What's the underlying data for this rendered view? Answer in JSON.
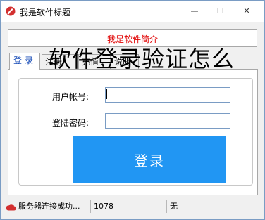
{
  "window": {
    "title": "我是软件标题",
    "minimize_glyph": "—",
    "maximize_glyph": "☐",
    "close_glyph": "✕"
  },
  "intro": {
    "text": "我是软件简介"
  },
  "overlay": {
    "text": "软件登录验证怎么"
  },
  "tabs": [
    {
      "label": "登录",
      "active": true
    },
    {
      "label": "注册"
    },
    {
      "label": "充值"
    },
    {
      "label": "说明"
    }
  ],
  "form": {
    "account_label": "用户帐号:",
    "account_value": "",
    "password_label": "登陆密码:",
    "password_value": "",
    "login_button": "登录"
  },
  "statusbar": {
    "server_status": "服务器连接成功...",
    "count": "1078",
    "info": "无"
  },
  "colors": {
    "accent": "#2196f3",
    "intro_text": "#e00000",
    "active_tab_text": "#1a4eb8",
    "status_icon": "#d32f2f"
  },
  "icons": {
    "app": "app-logo-icon",
    "status": "cloud-icon"
  }
}
